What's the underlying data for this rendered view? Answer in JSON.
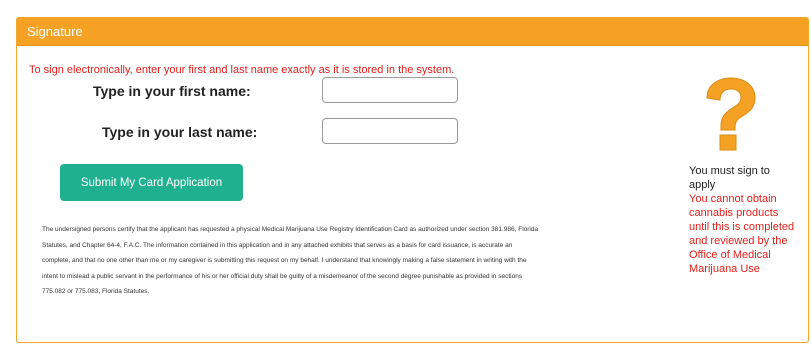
{
  "panel": {
    "title": "Signature"
  },
  "instruction": "To sign electronically, enter your first and last name exactly as it is stored in the system.",
  "form": {
    "first_name_label": "Type in your first name:",
    "first_name_value": "",
    "last_name_label": "Type in your last name:",
    "last_name_value": "",
    "submit_label": "Submit My Card Application"
  },
  "legal_text": "The undersigned persons certify that the applicant has requested a physical Medical Marijuana Use Registry Identification Card as authorized under section 381.986, Florida Statutes, and Chapter 64-4, F.A.C. The information contained in this application and in any attached exhibits that serves as a basis for card issuance, is accurate an complete, and that no one other than me or my caregiver is submitting this request on my behalf. I understand that knowingly making a false statement in writing with the intent to mislead a public servant in the performance of his or her official duty shall be guilty of a misdemeanor of the second degree punishable as provided in sections 775.082 or 775.083, Florida Statutes.",
  "side_note": {
    "icon": "question-mark-icon",
    "must_sign": "You must sign to apply",
    "warning": "You cannot obtain cannabis products until this is completed and reviewed by the Office of Medical Marijuana Use"
  },
  "colors": {
    "header": "#f5a224",
    "button": "#1fb08f",
    "warning": "#e0201b",
    "icon": "#f5a224"
  }
}
